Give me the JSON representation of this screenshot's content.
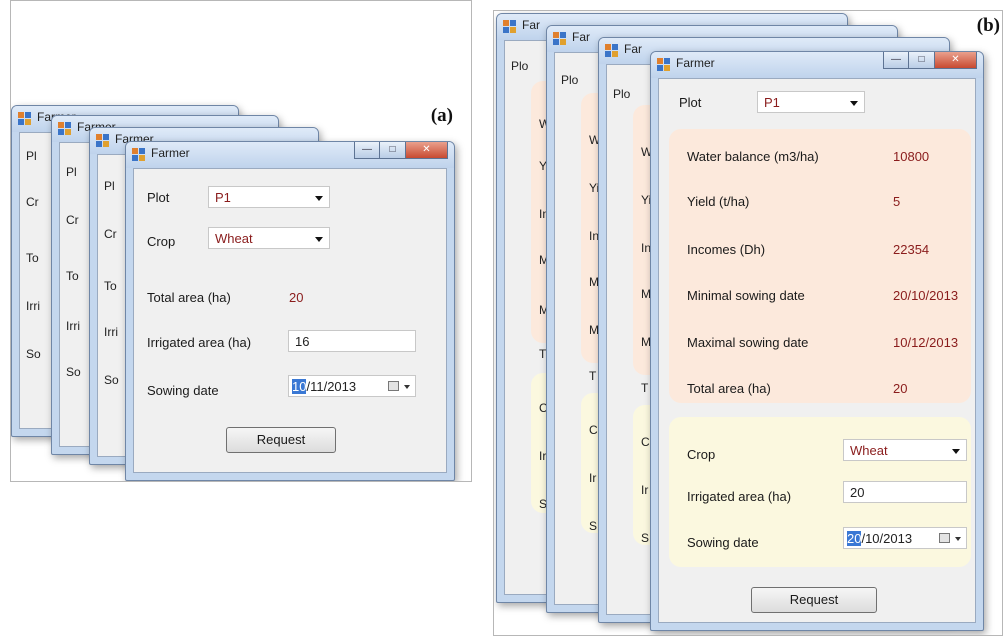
{
  "panel_a": {
    "label": "(a)",
    "window_title": "Farmer",
    "back_window_titles": [
      "Farmer",
      "Farmer",
      "Farmer"
    ],
    "peek_labels": [
      "Pl",
      "Cr",
      "To",
      "Irri",
      "So"
    ],
    "plot_label": "Plot",
    "plot_value": "P1",
    "crop_label": "Crop",
    "crop_value": "Wheat",
    "total_area_label": "Total area (ha)",
    "total_area_value": "20",
    "irrigated_area_label": "Irrigated area (ha)",
    "irrigated_area_value": "16",
    "sowing_date_label": "Sowing date",
    "sowing_date_sel": "10",
    "sowing_date_rest": "/11/2013",
    "request_label": "Request"
  },
  "panel_b": {
    "label": "(b)",
    "window_title": "Farmer",
    "back_window_titles": [
      "Far",
      "Far",
      "Far"
    ],
    "peek_labels": [
      "Plo",
      "W",
      "Yi",
      "In",
      "M",
      "M",
      "T",
      "C",
      "Ir",
      "S"
    ],
    "plot_label": "Plot",
    "plot_value": "P1",
    "info": [
      {
        "label": "Water balance (m3/ha)",
        "value": "10800"
      },
      {
        "label": "Yield (t/ha)",
        "value": "5"
      },
      {
        "label": "Incomes (Dh)",
        "value": "22354"
      },
      {
        "label": "Minimal sowing date",
        "value": "20/10/2013"
      },
      {
        "label": "Maximal sowing date",
        "value": "10/12/2013"
      },
      {
        "label": "Total area (ha)",
        "value": "20"
      }
    ],
    "crop_label": "Crop",
    "crop_value": "Wheat",
    "irrigated_area_label": "Irrigated area (ha)",
    "irrigated_area_value": "20",
    "sowing_date_label": "Sowing date",
    "sowing_date_sel": "20",
    "sowing_date_rest": "/10/2013",
    "request_label": "Request"
  }
}
